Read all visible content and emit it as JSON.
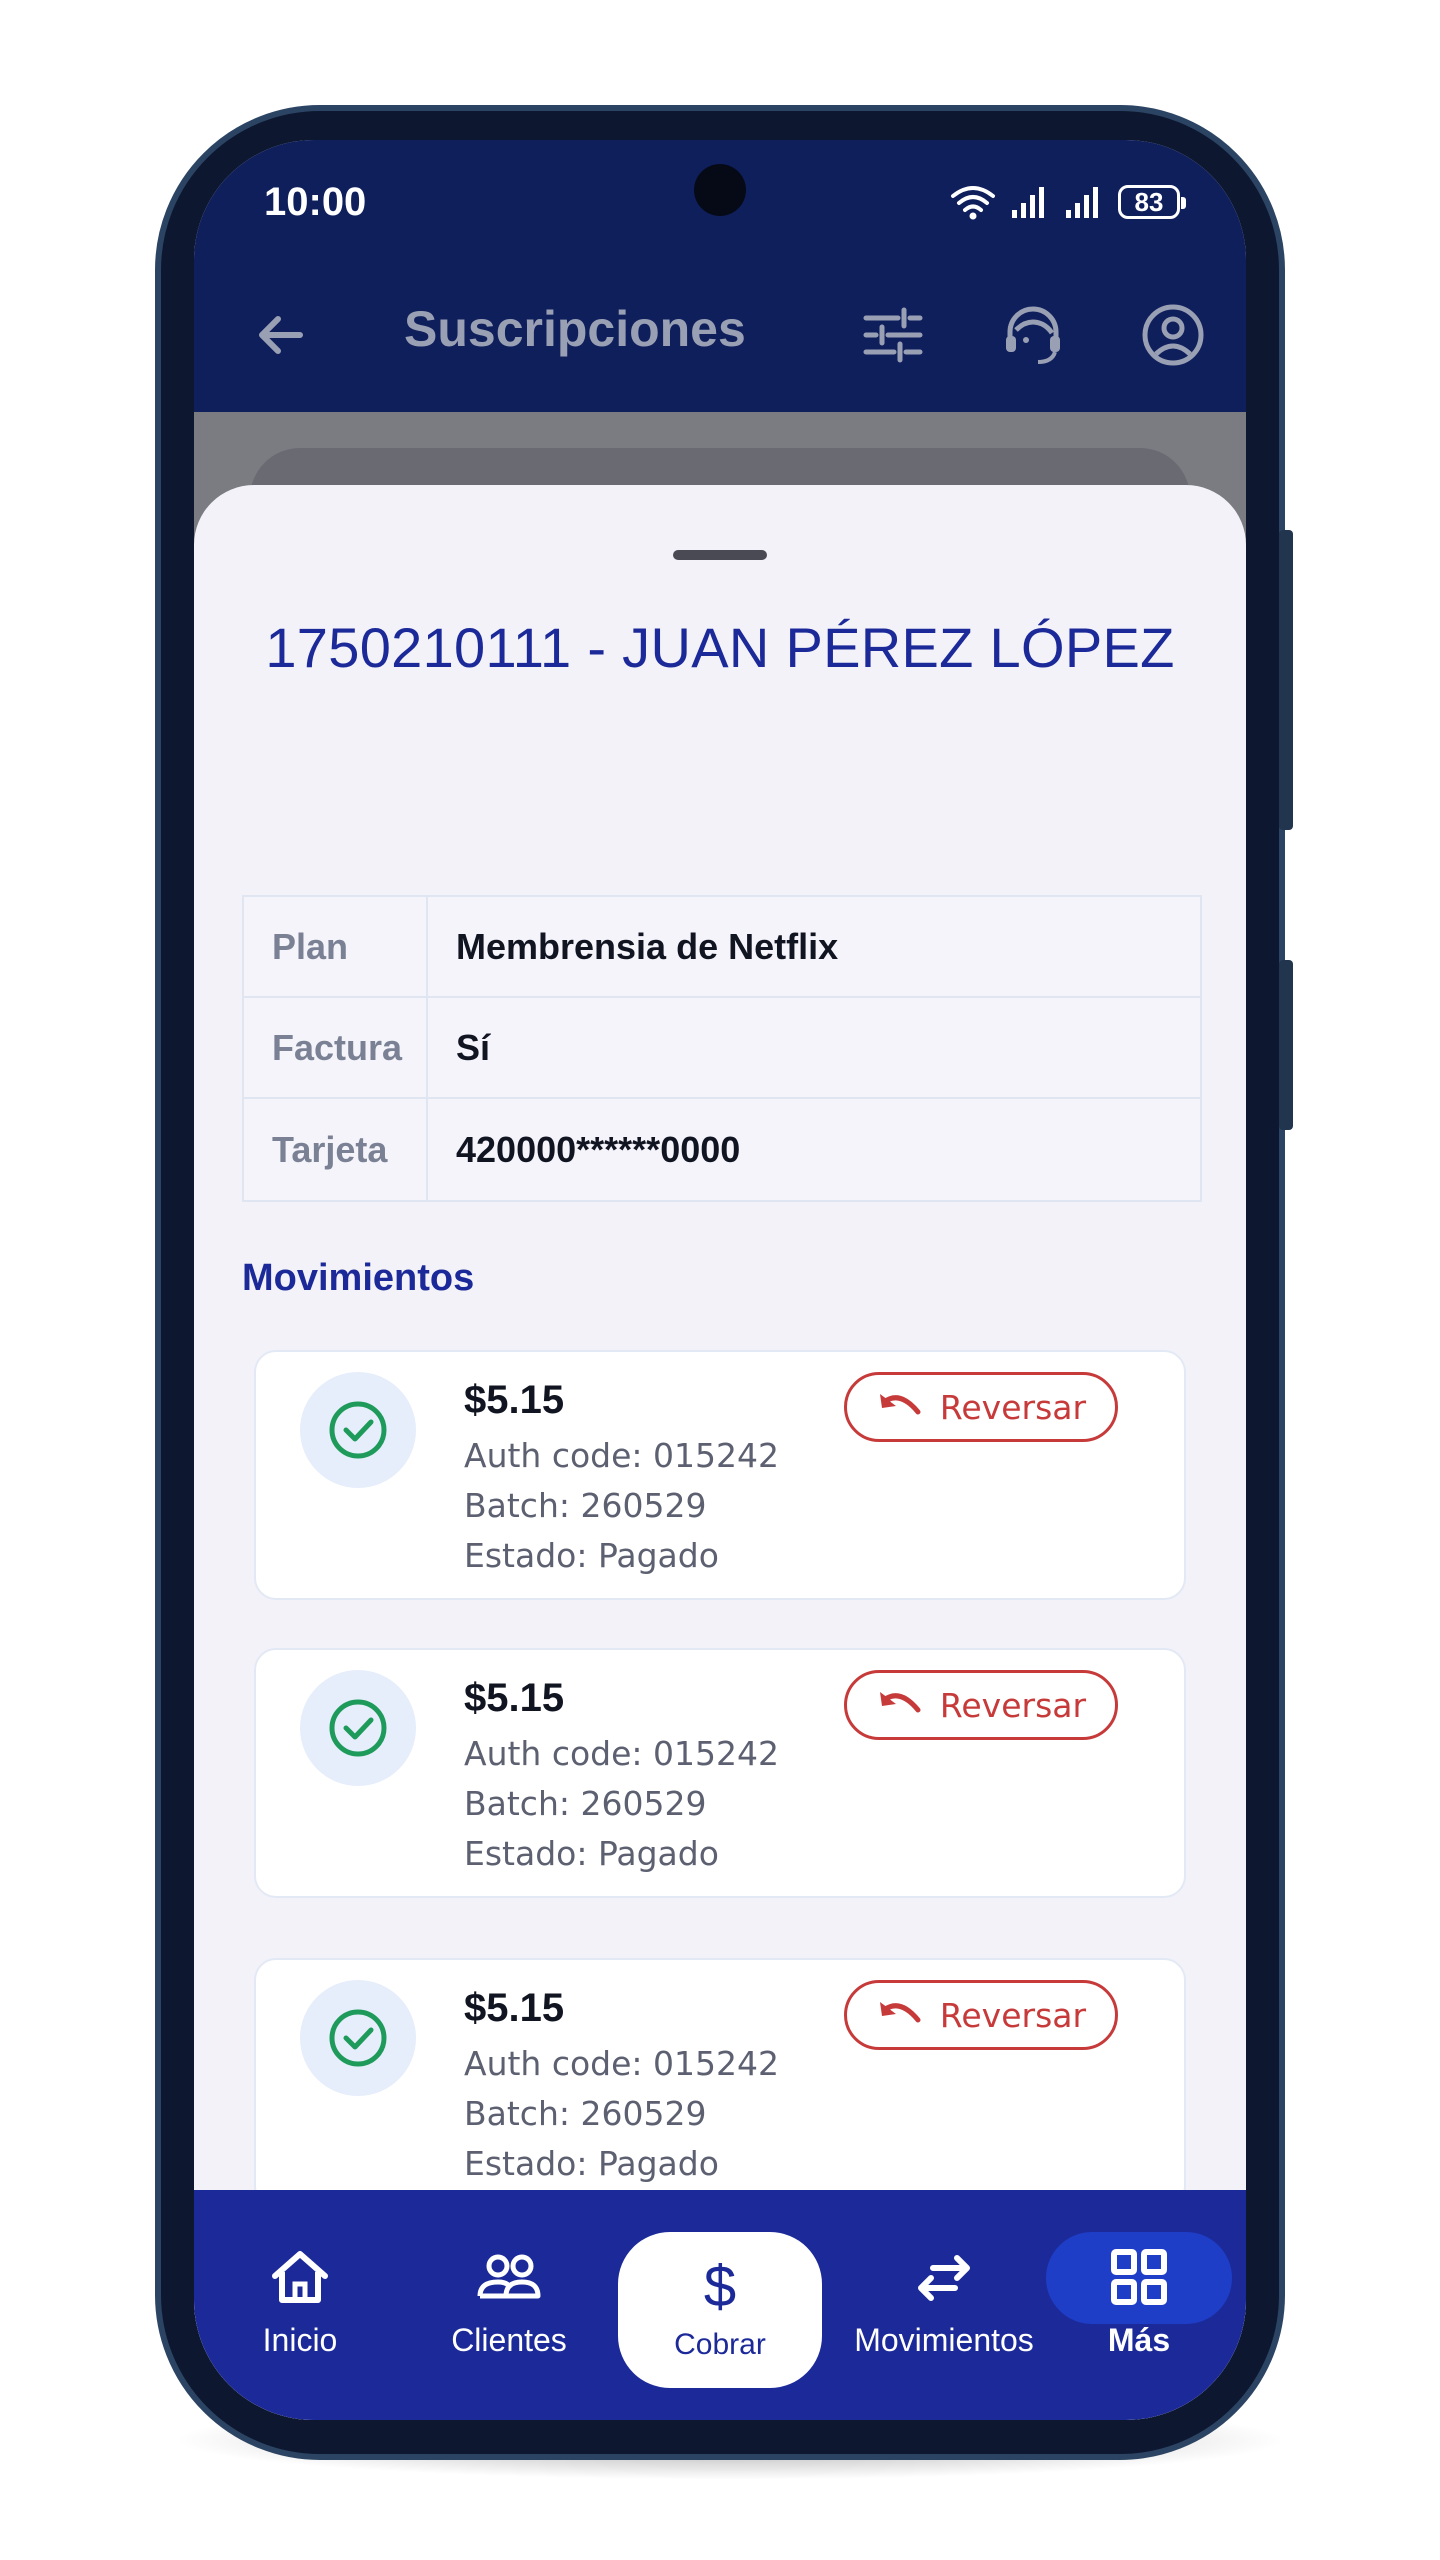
{
  "status_bar": {
    "time": "10:00",
    "battery": "83"
  },
  "header": {
    "title": "Suscripciones"
  },
  "sheet": {
    "customer_title": "1750210111 - JUAN PÉREZ LÓPEZ",
    "details": [
      {
        "label": "Plan",
        "value": "Membrensia de Netflix"
      },
      {
        "label": "Factura",
        "value": "Sí"
      },
      {
        "label": "Tarjeta",
        "value": "420000******0000"
      }
    ],
    "movements_title": "Movimientos",
    "movements": [
      {
        "amount": "$5.15",
        "auth": "Auth code: 015242",
        "batch": "Batch: 260529",
        "status": "Estado: Pagado",
        "action": "Reversar"
      },
      {
        "amount": "$5.15",
        "auth": "Auth code: 015242",
        "batch": "Batch: 260529",
        "status": "Estado: Pagado",
        "action": "Reversar"
      },
      {
        "amount": "$5.15",
        "auth": "Auth code: 015242",
        "batch": "Batch: 260529",
        "status": "Estado: Pagado",
        "action": "Reversar"
      }
    ]
  },
  "bottom_nav": {
    "items": [
      {
        "label": "Inicio",
        "icon": "home-icon"
      },
      {
        "label": "Clientes",
        "icon": "users-icon"
      },
      {
        "label": "Cobrar",
        "icon": "dollar-icon"
      },
      {
        "label": "Movimientos",
        "icon": "transfer-icon"
      },
      {
        "label": "Más",
        "icon": "grid-icon"
      }
    ]
  },
  "colors": {
    "primary": "#1c2a99",
    "header_bg": "#0f1f5c",
    "danger": "#c73a3a",
    "success": "#1e9a5a"
  }
}
